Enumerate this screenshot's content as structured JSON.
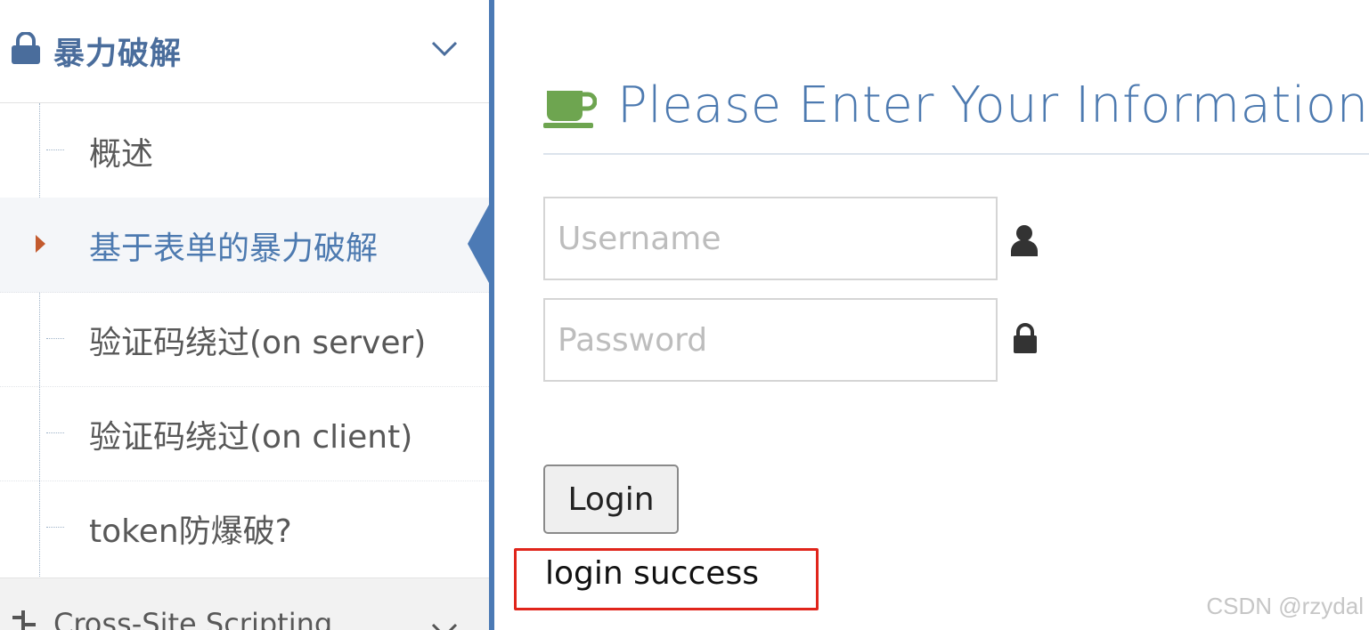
{
  "sidebar": {
    "section_title": "暴力破解",
    "section_icon": "lock-icon",
    "items": [
      {
        "label": "概述"
      },
      {
        "label": "基于表单的暴力破解",
        "active": true
      },
      {
        "label": "验证码绕过(on server)"
      },
      {
        "label": "验证码绕过(on client)"
      },
      {
        "label": "token防爆破?"
      }
    ],
    "next_section": "Cross-Site Scripting",
    "next_section_icon": "code-fork-icon"
  },
  "main": {
    "heading": "Please Enter Your Information",
    "heading_icon": "coffee-cup-icon",
    "username_placeholder": "Username",
    "password_placeholder": "Password",
    "login_label": "Login",
    "result_message": "login success"
  },
  "watermark": "CSDN @rzydal",
  "colors": {
    "accent_blue": "#4c7ab5",
    "heading_blue": "#4d7ab0",
    "cup_green": "#6ea550",
    "active_arrow": "#c35a2e",
    "highlight_red": "#e0251b"
  }
}
